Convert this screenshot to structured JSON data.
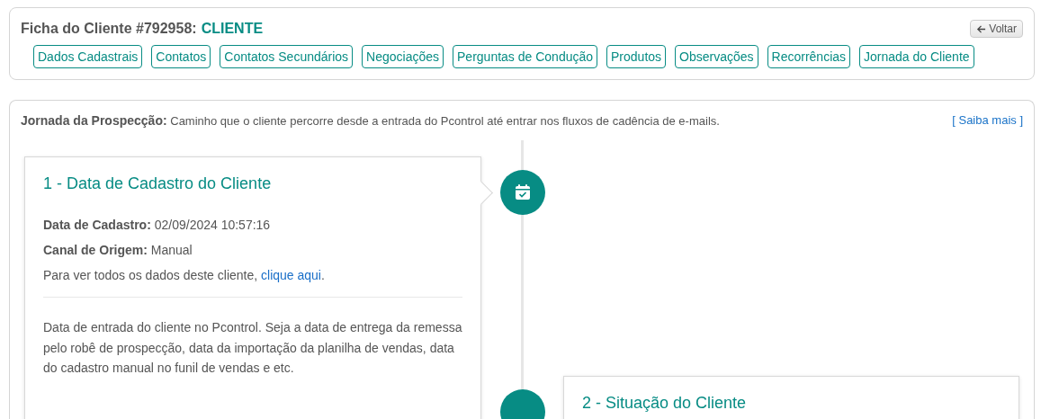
{
  "header": {
    "title": "Ficha do Cliente #792958:",
    "status": "CLIENTE",
    "back_button": "Voltar"
  },
  "tabs": [
    {
      "label": "Dados Cadastrais",
      "selected": false
    },
    {
      "label": "Contatos",
      "selected": false
    },
    {
      "label": "Contatos Secundários",
      "selected": false
    },
    {
      "label": "Negociações",
      "selected": false
    },
    {
      "label": "Perguntas de Condução",
      "selected": false
    },
    {
      "label": "Produtos",
      "selected": false
    },
    {
      "label": "Observações",
      "selected": false
    },
    {
      "label": "Recorrências",
      "selected": false
    },
    {
      "label": "Jornada do Cliente",
      "selected": false
    }
  ],
  "journey": {
    "intro": "**Jornada da Prospecção:** Caminho que o cliente percorre desde a entrada do Pcontrol até entrar nos fluxos de cadência de e-mails.",
    "learn_more": "[ Saiba mais ]",
    "steps": [
      {
        "title": "1 - Data de Cadastro do Cliente",
        "fields": [
          "**Data de Cadastro:** 02/09/2024 10:57:16",
          "**Canal de Origem:** Manual"
        ],
        "link_text": "Para ver todos os dados deste cliente, ",
        "link": "clique aqui",
        "link_end": ".",
        "note": "Data de entrada do cliente no Pcontrol. Seja a data de entrega da remessa pelo robê de prospecção, data da importação da planilha de vendas, data do cadastro manual no funil de vendas e etc."
      },
      {
        "title": "2 - Situação do Cliente"
      }
    ]
  }
}
